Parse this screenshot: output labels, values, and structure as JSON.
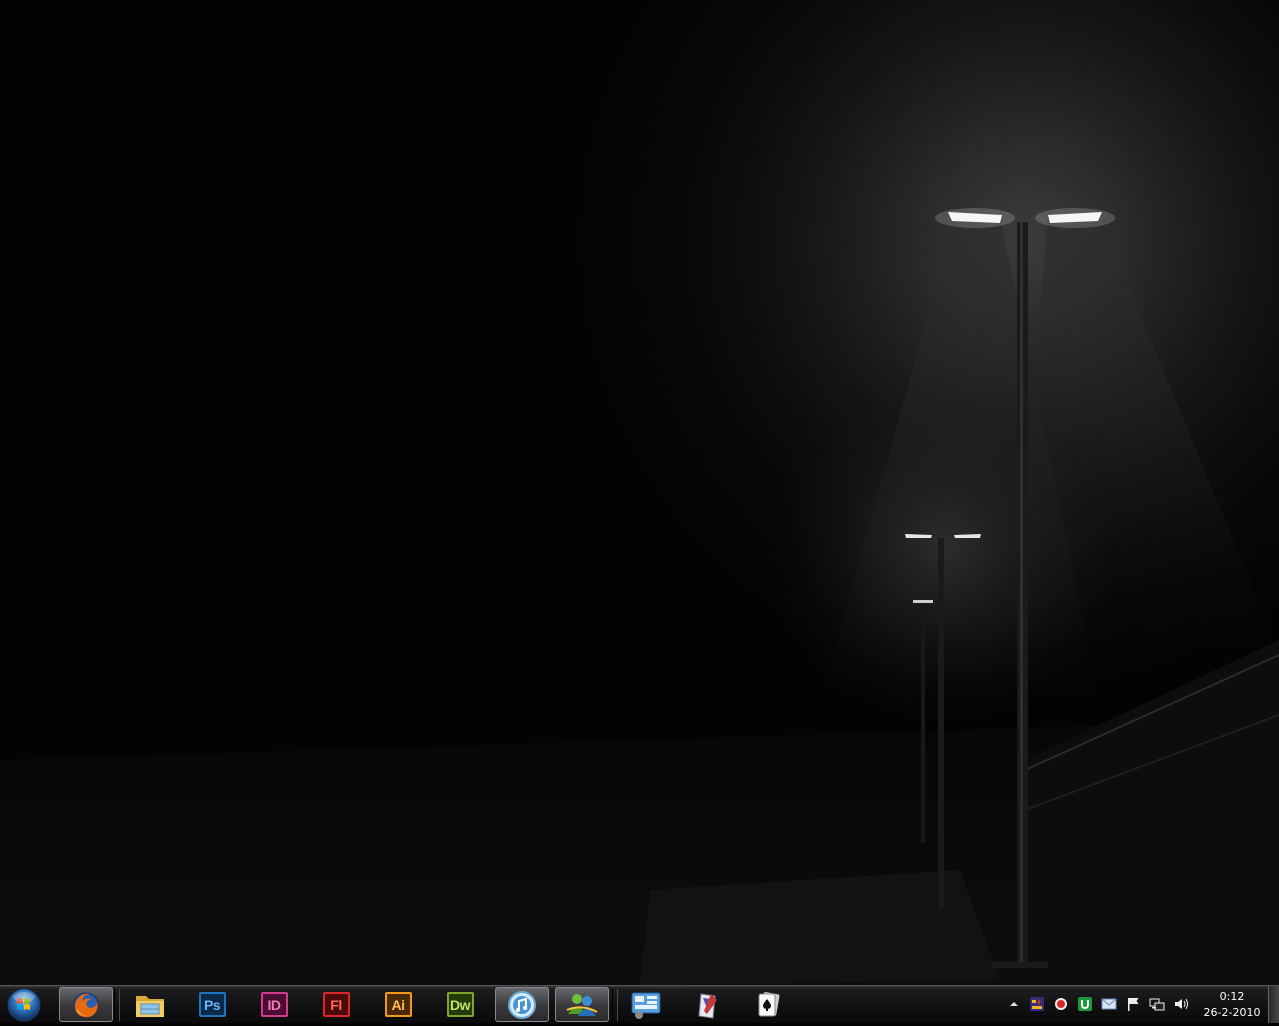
{
  "desktop": {
    "wallpaper": "foggy-night-street-lamps"
  },
  "taskbar": {
    "start_button": {
      "icon": "windows-orb-icon"
    },
    "items": [
      {
        "name": "firefox",
        "icon": "firefox-icon",
        "active": true
      },
      {
        "name": "windows-explorer",
        "icon": "folder-icon",
        "active": false
      },
      {
        "name": "photoshop",
        "icon": "photoshop-icon",
        "label": "Ps",
        "color": "#1e73be",
        "active": false
      },
      {
        "name": "indesign",
        "icon": "indesign-icon",
        "label": "ID",
        "color": "#d13c8e",
        "active": false
      },
      {
        "name": "flash",
        "icon": "flash-icon",
        "label": "Fl",
        "color": "#d8262a",
        "active": false
      },
      {
        "name": "illustrator",
        "icon": "illustrator-icon",
        "label": "Ai",
        "color": "#f39a1b",
        "active": false
      },
      {
        "name": "dreamweaver",
        "icon": "dreamweaver-icon",
        "label": "Dw",
        "color": "#7ba82a",
        "active": false
      },
      {
        "name": "itunes",
        "icon": "itunes-icon",
        "active": true
      },
      {
        "name": "messenger",
        "icon": "messenger-icon",
        "active": true
      },
      {
        "name": "control-panel",
        "icon": "control-panel-icon",
        "active": false
      },
      {
        "name": "tool",
        "icon": "tool-icon",
        "active": false
      },
      {
        "name": "solitaire",
        "icon": "card-icon",
        "active": false
      }
    ]
  },
  "tray": {
    "icons": [
      "show-hidden-chevron-icon",
      "winamp-icon",
      "record-icon",
      "utorrent-icon",
      "mail-icon",
      "action-center-flag-icon",
      "network-icon",
      "speaker-icon"
    ],
    "time": "0:12",
    "date": "26-2-2010"
  }
}
